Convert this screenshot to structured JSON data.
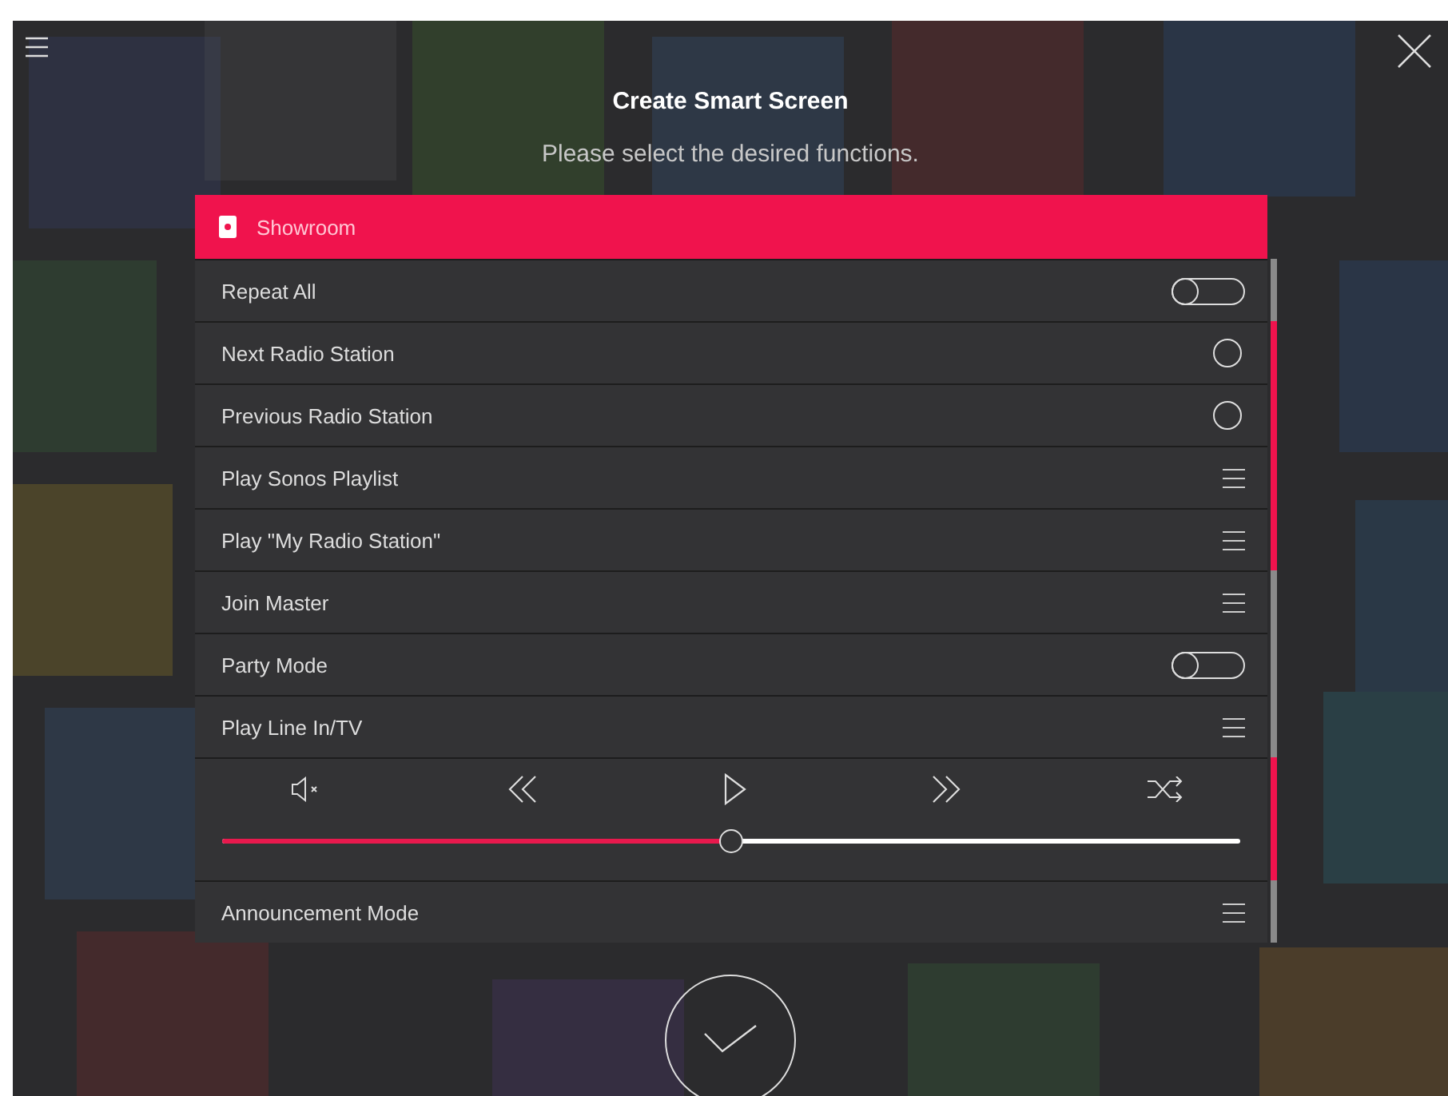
{
  "title": "Create Smart Screen",
  "subtitle": "Please select the desired functions.",
  "room": {
    "name": "Showroom"
  },
  "functions": [
    {
      "kind": "toggle",
      "label": "Repeat All",
      "on": false,
      "selected": false
    },
    {
      "kind": "radio",
      "label": "Next Radio Station",
      "checked": false,
      "selected": true
    },
    {
      "kind": "radio",
      "label": "Previous Radio Station",
      "checked": false,
      "selected": true
    },
    {
      "kind": "menu",
      "label": "Play Sonos Playlist",
      "selected": true
    },
    {
      "kind": "menu",
      "label": "Play \"My Radio Station\"",
      "selected": true
    },
    {
      "kind": "menu",
      "label": "Join Master",
      "selected": false
    },
    {
      "kind": "toggle",
      "label": "Party Mode",
      "on": false,
      "selected": false
    },
    {
      "kind": "menu",
      "label": "Play Line In/TV",
      "selected": false
    },
    {
      "kind": "player",
      "level": 0.5,
      "selected": true
    },
    {
      "kind": "menu",
      "label": "Announcement Mode",
      "selected": false
    }
  ]
}
